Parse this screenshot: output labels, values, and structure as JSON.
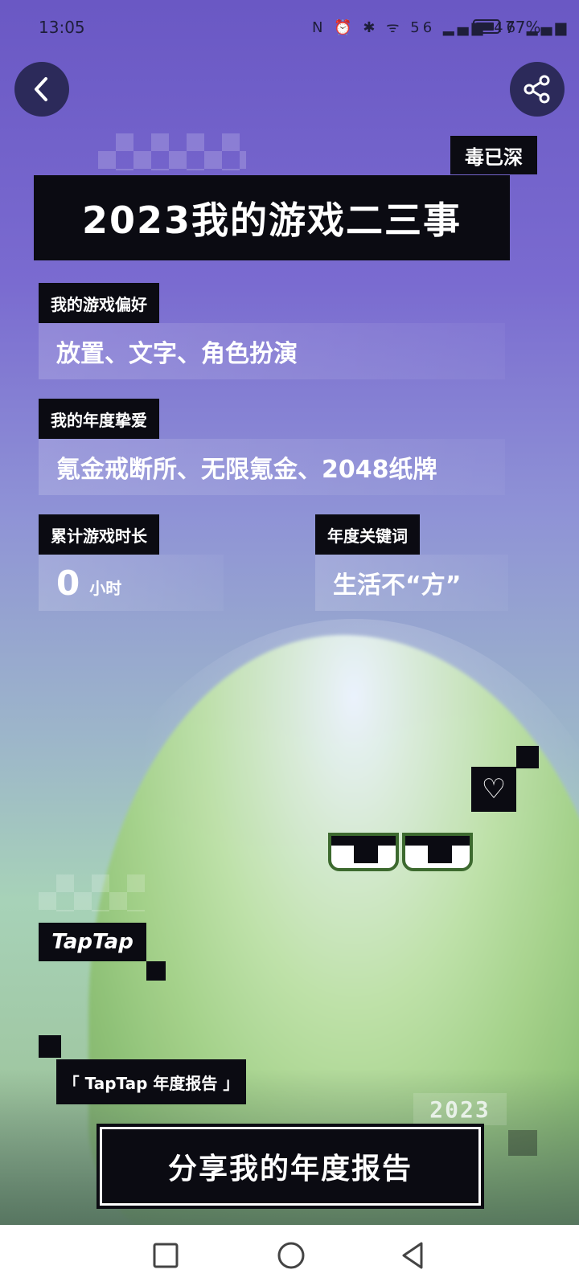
{
  "status_bar": {
    "time": "13:05",
    "signal_icons": "N ⏰ ✱ ᯤ 56 ▂▄▆ 46 ▂▄▆",
    "battery_percent": "77%"
  },
  "header": {
    "back_icon": "chevron-left-icon",
    "share_icon": "share-icon"
  },
  "report": {
    "badge": "毒已深",
    "title": "2023我的游戏二三事",
    "preference": {
      "label": "我的游戏偏好",
      "value": "放置、文字、角色扮演"
    },
    "favorites": {
      "label": "我的年度挚爱",
      "value": "氪金戒断所、无限氪金、2048纸牌"
    },
    "playtime": {
      "label": "累计游戏时长",
      "value": "0",
      "unit": "小时"
    },
    "keyword": {
      "label": "年度关键词",
      "value": "生活不“方”"
    }
  },
  "branding": {
    "logo_text": "TapTap",
    "report_tag": "「 TapTap 年度报告 」",
    "year": "2023"
  },
  "cta": {
    "label": "分享我的年度报告"
  },
  "colors": {
    "bg_top": "#6a58c4",
    "bg_bottom": "#a7d2b8",
    "block": "#0b0b12",
    "creature": "#a6d38a"
  }
}
